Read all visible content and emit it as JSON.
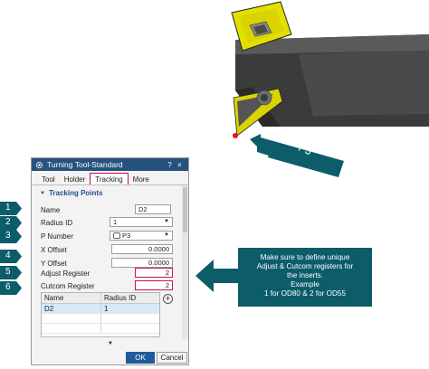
{
  "dialog": {
    "title": "Turning Tool-Standard",
    "help_label": "?",
    "close_label": "×",
    "tabs": [
      "Tool",
      "Holder",
      "Tracking",
      "More"
    ],
    "active_tab": "Tracking",
    "section_title": "Tracking Points",
    "fields": {
      "name": {
        "label": "Name",
        "value": "D2"
      },
      "radius_id": {
        "label": "Radius ID",
        "value": "1"
      },
      "p_number": {
        "label": "P Number",
        "value": "P3"
      },
      "x_offset": {
        "label": "X Offset",
        "value": "0.0000"
      },
      "y_offset": {
        "label": "Y Offset",
        "value": "0.0000"
      },
      "adjust_register": {
        "label": "Adjust Register",
        "value": "2"
      },
      "cutcom_register": {
        "label": "Cutcom Register",
        "value": "2"
      }
    },
    "table": {
      "columns": [
        "Name",
        "Radius ID"
      ],
      "rows": [
        [
          "D2",
          "1"
        ]
      ]
    },
    "ok_label": "OK",
    "cancel_label": "Cancel"
  },
  "badges": [
    "1",
    "2",
    "3",
    "4",
    "5",
    "6"
  ],
  "callout_p3": "P3",
  "info_callout": {
    "lines": [
      "Make sure to define unique",
      "Adjust & Cutcom registers for",
      "the inserts.",
      "Example",
      "1 for OD80 & 2 for OD55"
    ]
  },
  "colors": {
    "titlebar": "#27527f",
    "highlight": "#d0124a",
    "callout": "#0c5c6a",
    "insert": "#e3e000"
  }
}
